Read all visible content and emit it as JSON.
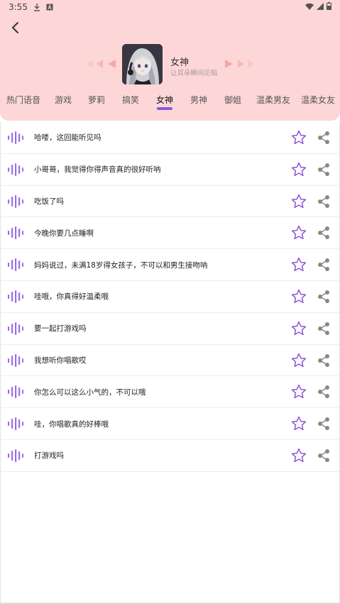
{
  "status_bar": {
    "time": "3:55",
    "icons": [
      "download-icon",
      "a-icon",
      "wifi-icon",
      "signal-icon",
      "battery-icon"
    ]
  },
  "header": {
    "back_icon": "chevron-left-icon",
    "title": "女神",
    "subtitle": "让耳朵瞬间沦陷",
    "accent_color": "#8a58d8",
    "background_color": "#fdd7d7"
  },
  "tabs": [
    {
      "label": "热门语音",
      "active": false
    },
    {
      "label": "游戏",
      "active": false
    },
    {
      "label": "萝莉",
      "active": false
    },
    {
      "label": "搞笑",
      "active": false
    },
    {
      "label": "女神",
      "active": true
    },
    {
      "label": "男神",
      "active": false
    },
    {
      "label": "御姐",
      "active": false
    },
    {
      "label": "温柔男友",
      "active": false
    },
    {
      "label": "温柔女友",
      "active": false
    }
  ],
  "items": [
    {
      "text": "哈喽，这回能听见吗"
    },
    {
      "text": "小哥哥，我觉得你得声音真的很好听呐"
    },
    {
      "text": "吃饭了吗"
    },
    {
      "text": "今晚你要几点睡啊"
    },
    {
      "text": "妈妈说过，未满18岁得女孩子，不可以和男生接吻呐"
    },
    {
      "text": "哇哦，你真得好温柔哦"
    },
    {
      "text": "要一起打游戏吗"
    },
    {
      "text": "我想听你唱歌哎"
    },
    {
      "text": "你怎么可以这么小气的，不可以哦"
    },
    {
      "text": "哇，你唱歌真的好棒哦"
    },
    {
      "text": "打游戏吗"
    }
  ]
}
